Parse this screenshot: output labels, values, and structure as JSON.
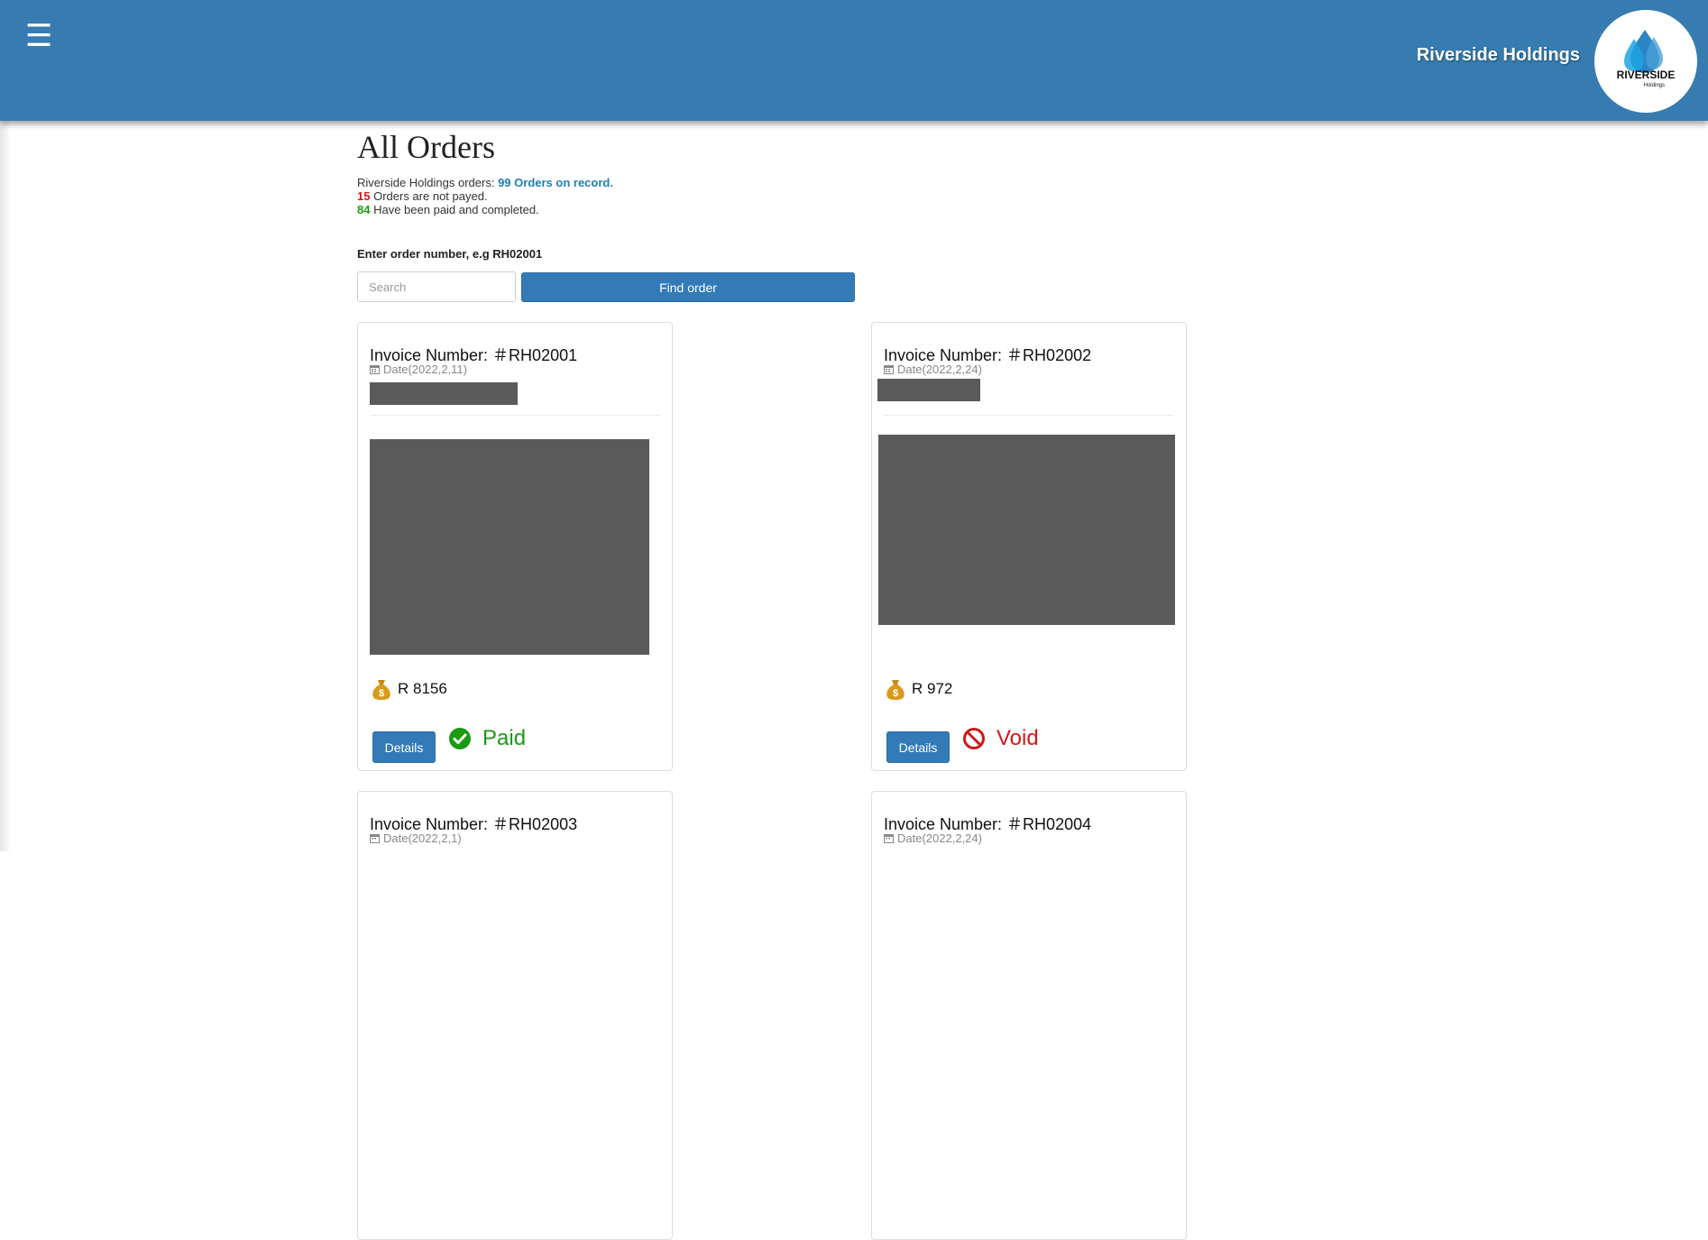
{
  "header": {
    "menu_icon": "hamburger-menu-icon",
    "brand_name": "Riverside Holdings",
    "logo_text": "RIVERSIDE",
    "logo_subtext": "Holdings",
    "background_color": "#367cb0"
  },
  "page": {
    "title": "All Orders"
  },
  "summary": {
    "line1_prefix": "Riverside Holdings orders:",
    "line1_highlight": "99 Orders on record.",
    "not_paid_count": "15",
    "not_paid_text": "Orders are not payed.",
    "paid_count": "84",
    "paid_text": "Have been paid and completed."
  },
  "search": {
    "label": "Enter order number, e.g RH02001",
    "placeholder": "Search",
    "value": "",
    "button_label": "Find order"
  },
  "orders": [
    {
      "invoice_label": "Invoice Number: ＃RH02001",
      "date": "Date(2022,2,11)",
      "amount": "R 8156",
      "details_label": "Details",
      "status": "Paid",
      "status_icon": "check-circle-icon"
    },
    {
      "invoice_label": "Invoice Number: ＃RH02002",
      "date": "Date(2022,2,24)",
      "amount": "R 972",
      "details_label": "Details",
      "status": "Void",
      "status_icon": "prohibited-icon"
    },
    {
      "invoice_label": "Invoice Number: ＃RH02003",
      "date": "Date(2022,2,1)"
    },
    {
      "invoice_label": "Invoice Number: ＃RH02004",
      "date": "Date(2022,2,24)"
    }
  ],
  "colors": {
    "primary": "#337ab7",
    "paid": "#1a9b12",
    "void": "#d01818",
    "highlight_blue": "#1f7fb3",
    "redaction": "#5a5a5a"
  }
}
